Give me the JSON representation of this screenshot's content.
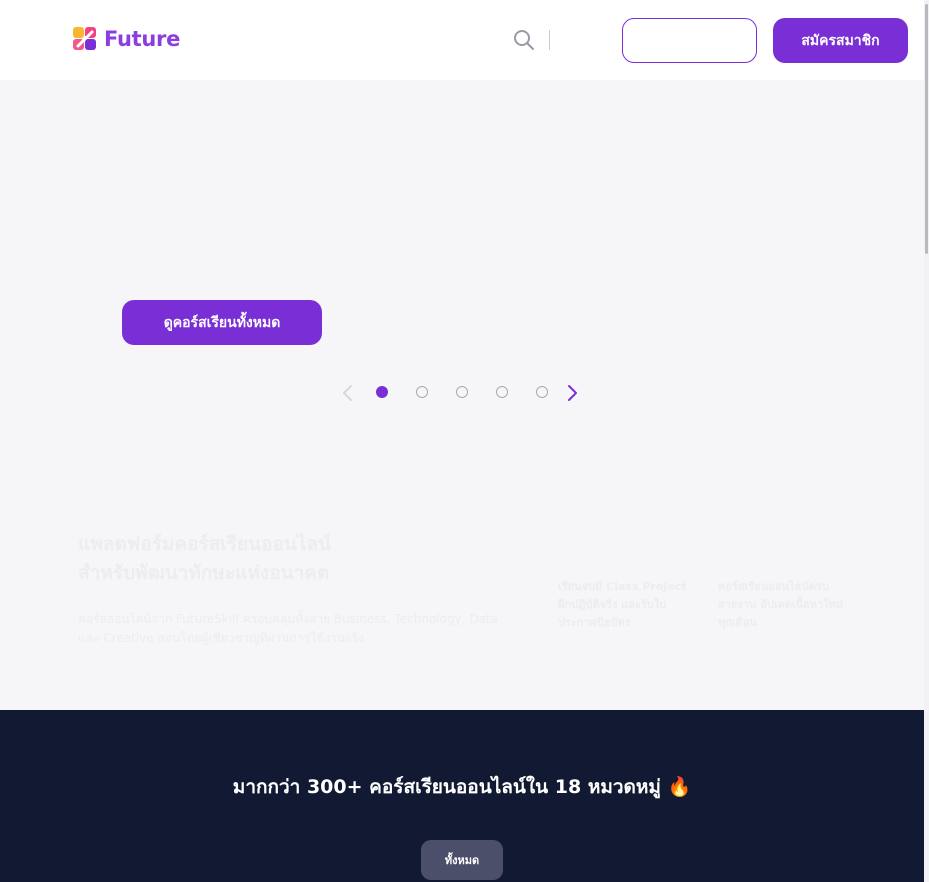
{
  "header": {
    "logo_text": "Future",
    "login_label": "",
    "signup_label": "สมัครสมาชิก"
  },
  "hero": {
    "cta_label": "ดูคอร์สเรียนทั้งหมด",
    "carousel": {
      "slide_count": 5,
      "active_slide": 1
    }
  },
  "platform": {
    "title_line1": "แพลตฟอร์มคอร์สเรียนออนไลน์",
    "title_line2": "สำหรับพัฒนาทักษะแห่งอนาคต",
    "description": "คอร์สออนไลน์จาก FutureSkill ครอบคลุมทั้งสาย Business, Technology, Data และ Creative สอนโดยผู้เชี่ยวชาญที่ผ่านการใช้งานจริง",
    "features": [
      "เรียนจบมี Class Project ฝึกปฏิบัติจริง และรับใบประกาศนียบัตร",
      "คอร์สเรียนออนไลน์ครบ สายงาน อัปเดตเนื้อหาใหม่ทุกเดือน"
    ]
  },
  "categories": {
    "heading": "มากกว่า 300+ คอร์สเรียนออนไลน์ใน 18 หมวดหมู่ 🔥",
    "filter_all_label": "ทั้งหมด"
  },
  "colors": {
    "brand_purple": "#7a2ed6",
    "dark_navy": "#111a32"
  }
}
